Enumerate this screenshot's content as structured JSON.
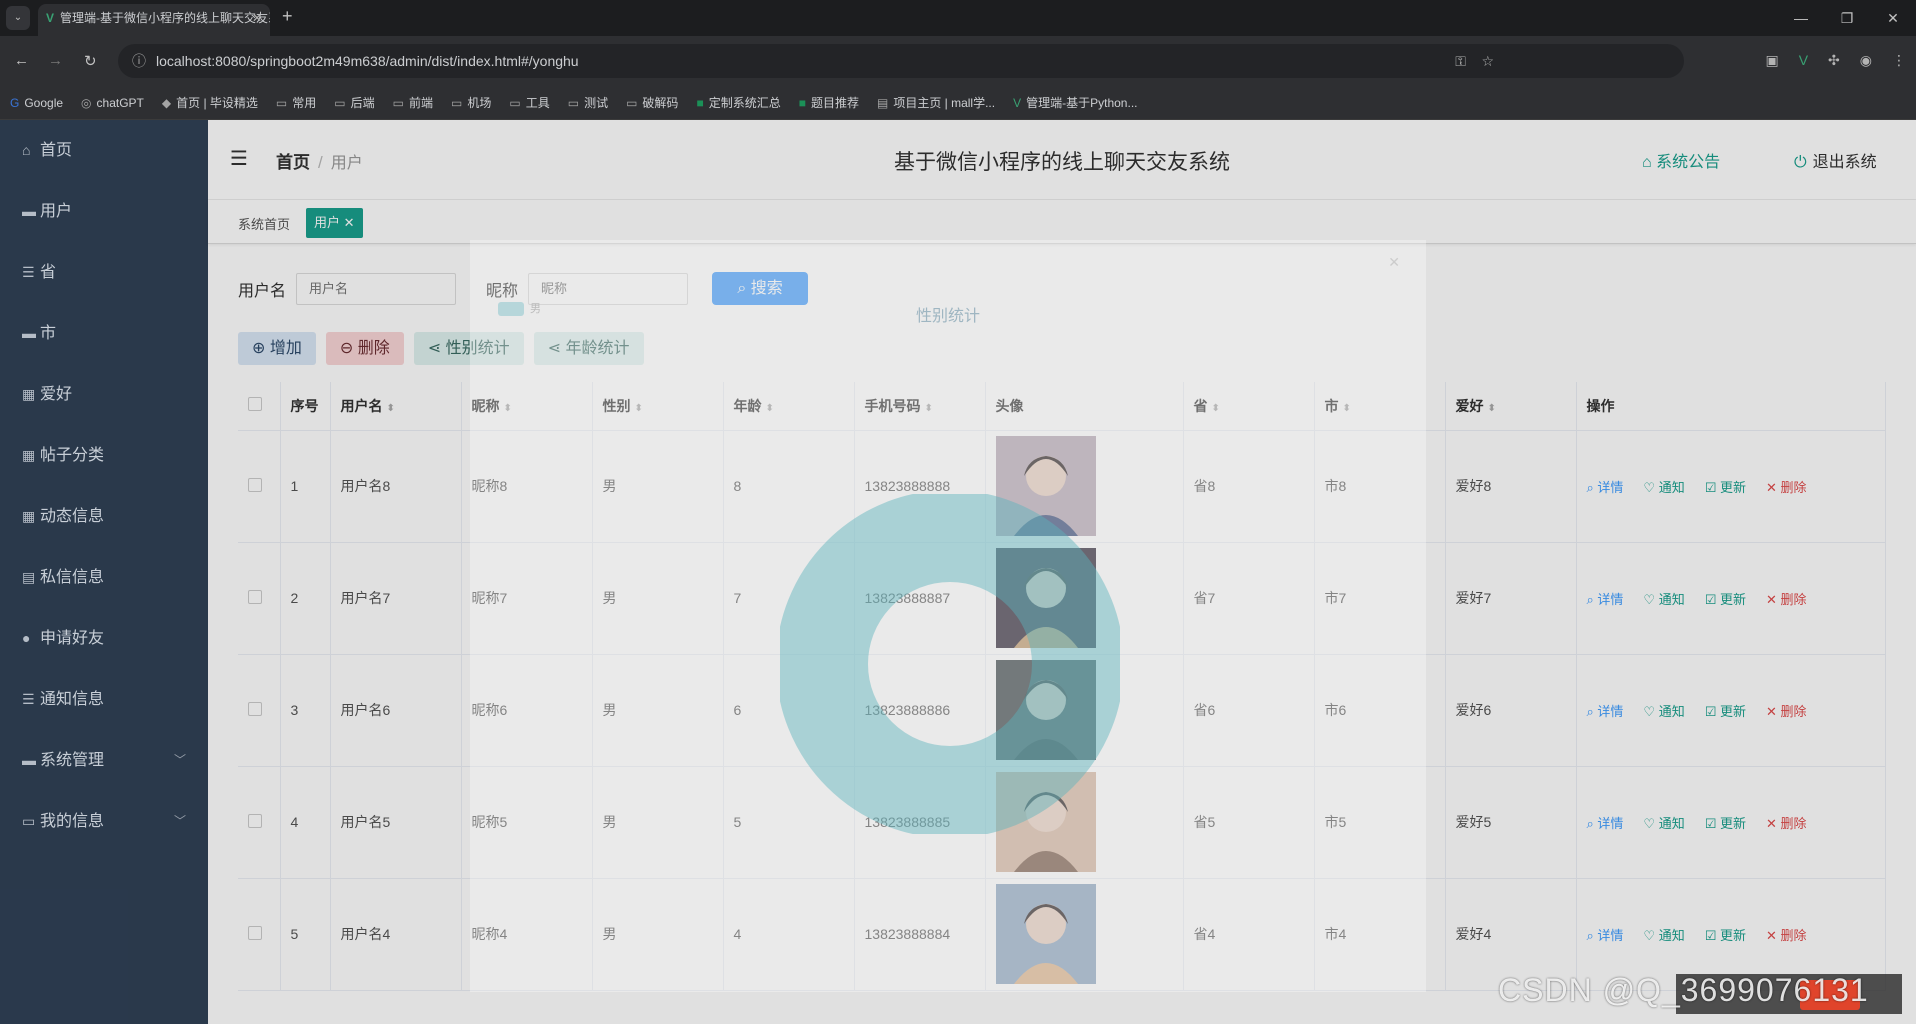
{
  "browser": {
    "tab_title": "管理端-基于微信小程序的线上聊天交友系统",
    "url": "localhost:8080/springboot2m49m638/admin/dist/index.html#/yonghu",
    "bookmarks": [
      "Google",
      "chatGPT",
      "首页 | 毕设精选",
      "常用",
      "后端",
      "前端",
      "机场",
      "工具",
      "测试",
      "破解码",
      "定制系统汇总",
      "题目推荐",
      "项目主页 | mall学...",
      "管理端-基于Python..."
    ]
  },
  "sidebar": {
    "items": [
      {
        "label": "首页",
        "icon": "home-icon"
      },
      {
        "label": "用户",
        "icon": "user-icon"
      },
      {
        "label": "省",
        "icon": "sliders-icon"
      },
      {
        "label": "市",
        "icon": "message-icon"
      },
      {
        "label": "爱好",
        "icon": "grid-icon"
      },
      {
        "label": "帖子分类",
        "icon": "grid-icon"
      },
      {
        "label": "动态信息",
        "icon": "grid-icon"
      },
      {
        "label": "私信信息",
        "icon": "clipboard-icon"
      },
      {
        "label": "申请好友",
        "icon": "person-icon"
      },
      {
        "label": "通知信息",
        "icon": "list-icon"
      },
      {
        "label": "系统管理",
        "icon": "message-icon"
      },
      {
        "label": "我的信息",
        "icon": "window-icon"
      }
    ]
  },
  "header": {
    "breadcrumb_home": "首页",
    "breadcrumb_current": "用户",
    "title": "基于微信小程序的线上聊天交友系统",
    "notice": "系统公告",
    "logout": "退出系统"
  },
  "tags": {
    "home": "系统首页",
    "active": "用户"
  },
  "search": {
    "username_label": "用户名",
    "username_placeholder": "用户名",
    "nickname_label": "昵称",
    "nickname_placeholder": "昵称",
    "button": "搜索"
  },
  "actions": {
    "add": "增加",
    "delete": "删除",
    "gender_stats": "性别统计",
    "age_stats": "年龄统计"
  },
  "table": {
    "headers": [
      "序号",
      "用户名",
      "昵称",
      "性别",
      "年龄",
      "手机号码",
      "头像",
      "省",
      "市",
      "爱好",
      "操作"
    ],
    "ops": {
      "detail": "详情",
      "notify": "通知",
      "update": "更新",
      "delete": "删除"
    },
    "rows": [
      {
        "no": "1",
        "username": "用户名8",
        "nickname": "昵称8",
        "gender": "男",
        "age": "8",
        "phone": "13823888888",
        "province": "省8",
        "city": "市8",
        "hobby": "爱好8"
      },
      {
        "no": "2",
        "username": "用户名7",
        "nickname": "昵称7",
        "gender": "男",
        "age": "7",
        "phone": "13823888887",
        "province": "省7",
        "city": "市7",
        "hobby": "爱好7"
      },
      {
        "no": "3",
        "username": "用户名6",
        "nickname": "昵称6",
        "gender": "男",
        "age": "6",
        "phone": "13823888886",
        "province": "省6",
        "city": "市6",
        "hobby": "爱好6"
      },
      {
        "no": "4",
        "username": "用户名5",
        "nickname": "昵称5",
        "gender": "男",
        "age": "5",
        "phone": "13823888885",
        "province": "省5",
        "city": "市5",
        "hobby": "爱好5"
      },
      {
        "no": "5",
        "username": "用户名4",
        "nickname": "昵称4",
        "gender": "男",
        "age": "4",
        "phone": "13823888884",
        "province": "省4",
        "city": "市4",
        "hobby": "爱好4"
      }
    ]
  },
  "dialog": {
    "title": "性别统计",
    "legend": "男"
  },
  "watermark": "CSDN @Q_3699076131",
  "colors": {
    "sidebar_bg": "#304156",
    "accent": "#1aa08e",
    "primary": "#409eff",
    "danger": "#e04a4a",
    "donut": "#5ab4bc"
  }
}
